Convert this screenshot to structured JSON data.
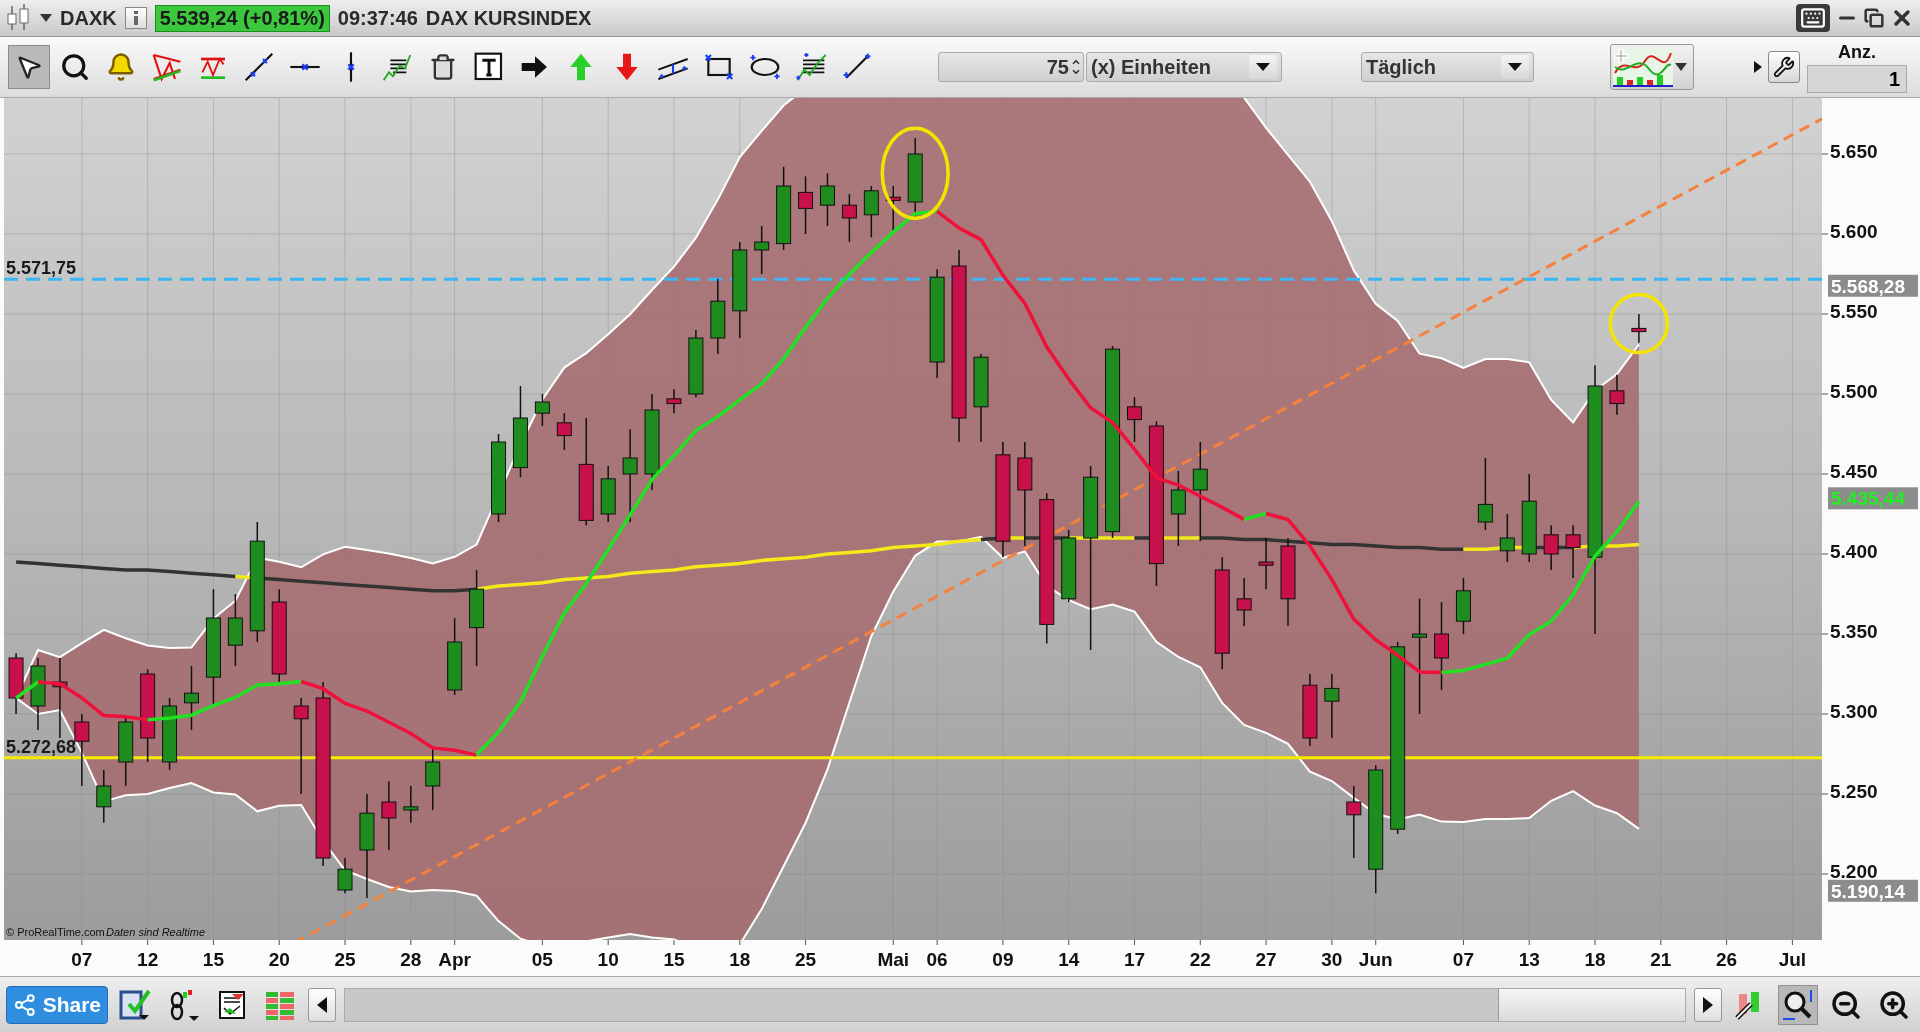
{
  "window": {
    "symbol": "DAXK",
    "quote": "5.539,24 (+0,81%)",
    "time": "09:37:46",
    "instrument": "DAX KURSINDEX"
  },
  "toolbar": {
    "tools": [
      {
        "kind": "pointer",
        "selected": true
      },
      {
        "kind": "zoom",
        "selected": false
      },
      {
        "kind": "alert",
        "selected": false
      },
      {
        "kind": "triangle",
        "selected": false
      },
      {
        "kind": "channel",
        "selected": false
      },
      {
        "kind": "line",
        "selected": false
      },
      {
        "kind": "hline",
        "selected": false
      },
      {
        "kind": "vline",
        "selected": false
      },
      {
        "kind": "analysis",
        "selected": false
      },
      {
        "kind": "trash",
        "selected": false
      },
      {
        "kind": "text",
        "selected": false
      },
      {
        "kind": "arrow-right",
        "selected": false
      },
      {
        "kind": "arrow-up",
        "selected": false
      },
      {
        "kind": "arrow-down",
        "selected": false
      },
      {
        "kind": "parallel",
        "selected": false
      },
      {
        "kind": "rectangle",
        "selected": false
      },
      {
        "kind": "ellipse",
        "selected": false
      },
      {
        "kind": "fibonacci",
        "selected": false
      },
      {
        "kind": "segment",
        "selected": false
      }
    ],
    "units_value": "75",
    "units_label": "(x) Einheiten",
    "interval": "Täglich",
    "count_label": "Anz.",
    "count_value": "1"
  },
  "chart": {
    "credit": "© ProRealTime.com",
    "credit_note": "Daten sind Realtime",
    "price_labels": [
      "5.571,75",
      "5.272,68"
    ],
    "y_axis_labels": [
      "5.650",
      "5.600",
      "5.550",
      "5.500",
      "5.450",
      "5.400",
      "5.350",
      "5.300",
      "5.250",
      "5.200"
    ],
    "x_axis_labels": [
      "07",
      "12",
      "15",
      "20",
      "25",
      "28",
      "Apr",
      "05",
      "10",
      "15",
      "18",
      "25",
      "Mai",
      "06",
      "09",
      "14",
      "17",
      "22",
      "27",
      "30",
      "Jun",
      "07",
      "13",
      "18",
      "21",
      "26",
      "Jul"
    ],
    "price_tags": [
      {
        "label": "5.568,28",
        "kind": "level"
      },
      {
        "label": "5.435,44",
        "kind": "average"
      },
      {
        "label": "5.190,14",
        "kind": "band"
      }
    ]
  },
  "bottom_bar": {
    "share": "Share"
  }
}
